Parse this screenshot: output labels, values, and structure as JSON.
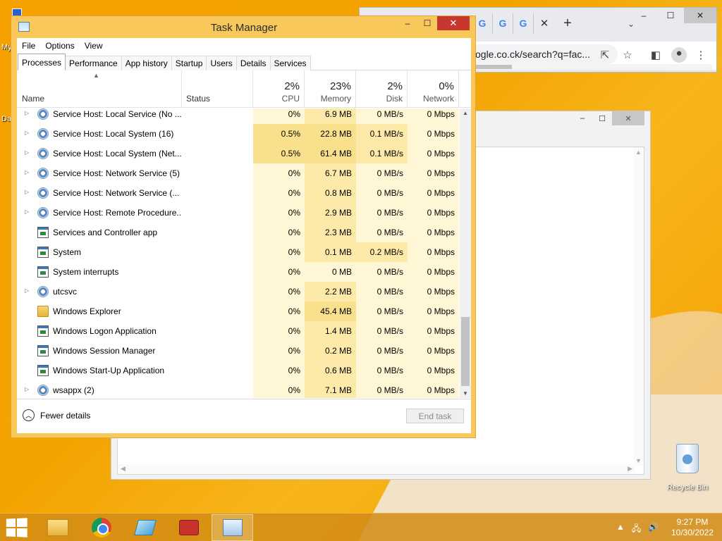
{
  "desktop": {
    "frag_my": "My",
    "frag_da": "Da",
    "recycle_bin_label": "Recycle Bin"
  },
  "chrome": {
    "tab_favicon": "G",
    "tab_close": "✕",
    "new_tab": "+",
    "tab_dropdown": "⌄",
    "url": "ogle.co.ck/search?q=fac...",
    "minimize": "–",
    "maximize": "☐",
    "close": "✕"
  },
  "explorer": {
    "minimize": "–",
    "maximize": "☐",
    "close": "✕"
  },
  "task_manager": {
    "title": "Task Manager",
    "minimize": "–",
    "maximize": "☐",
    "close": "✕",
    "menu": [
      "File",
      "Options",
      "View"
    ],
    "tabs": [
      "Processes",
      "Performance",
      "App history",
      "Startup",
      "Users",
      "Details",
      "Services"
    ],
    "active_tab": "Processes",
    "columns": {
      "name": "Name",
      "status": "Status",
      "cpu_pct": "2%",
      "cpu": "CPU",
      "memory_pct": "23%",
      "memory": "Memory",
      "disk_pct": "2%",
      "disk": "Disk",
      "network_pct": "0%",
      "network": "Network"
    },
    "processes": [
      {
        "name": "Service Host: Local Service (No ...",
        "expandable": true,
        "icon": "gear-icon",
        "cpu": "0%",
        "memory": "6.9 MB",
        "disk": "0 MB/s",
        "network": "0 Mbps"
      },
      {
        "name": "Service Host: Local System (16)",
        "expandable": true,
        "icon": "gear-icon",
        "cpu": "0.5%",
        "memory": "22.8 MB",
        "disk": "0.1 MB/s",
        "network": "0 Mbps"
      },
      {
        "name": "Service Host: Local System (Net...",
        "expandable": true,
        "icon": "gear-icon",
        "cpu": "0.5%",
        "memory": "61.4 MB",
        "disk": "0.1 MB/s",
        "network": "0 Mbps"
      },
      {
        "name": "Service Host: Network Service (5)",
        "expandable": true,
        "icon": "gear-icon",
        "cpu": "0%",
        "memory": "6.7 MB",
        "disk": "0 MB/s",
        "network": "0 Mbps"
      },
      {
        "name": "Service Host: Network Service (...",
        "expandable": true,
        "icon": "gear-icon",
        "cpu": "0%",
        "memory": "0.8 MB",
        "disk": "0 MB/s",
        "network": "0 Mbps"
      },
      {
        "name": "Service Host: Remote Procedure...",
        "expandable": true,
        "icon": "gear-icon",
        "cpu": "0%",
        "memory": "2.9 MB",
        "disk": "0 MB/s",
        "network": "0 Mbps"
      },
      {
        "name": "Services and Controller app",
        "expandable": false,
        "icon": "app-window-icon",
        "cpu": "0%",
        "memory": "2.3 MB",
        "disk": "0 MB/s",
        "network": "0 Mbps"
      },
      {
        "name": "System",
        "expandable": false,
        "icon": "app-window-icon",
        "cpu": "0%",
        "memory": "0.1 MB",
        "disk": "0.2 MB/s",
        "network": "0 Mbps"
      },
      {
        "name": "System interrupts",
        "expandable": false,
        "icon": "app-window-icon",
        "cpu": "0%",
        "memory": "0 MB",
        "disk": "0 MB/s",
        "network": "0 Mbps"
      },
      {
        "name": "utcsvc",
        "expandable": true,
        "icon": "gear-icon",
        "cpu": "0%",
        "memory": "2.2 MB",
        "disk": "0 MB/s",
        "network": "0 Mbps"
      },
      {
        "name": "Windows Explorer",
        "expandable": false,
        "icon": "folder-icon",
        "cpu": "0%",
        "memory": "45.4 MB",
        "disk": "0 MB/s",
        "network": "0 Mbps"
      },
      {
        "name": "Windows Logon Application",
        "expandable": false,
        "icon": "app-window-icon",
        "cpu": "0%",
        "memory": "1.4 MB",
        "disk": "0 MB/s",
        "network": "0 Mbps"
      },
      {
        "name": "Windows Session Manager",
        "expandable": false,
        "icon": "app-window-icon",
        "cpu": "0%",
        "memory": "0.2 MB",
        "disk": "0 MB/s",
        "network": "0 Mbps"
      },
      {
        "name": "Windows Start-Up Application",
        "expandable": false,
        "icon": "app-window-icon",
        "cpu": "0%",
        "memory": "0.6 MB",
        "disk": "0 MB/s",
        "network": "0 Mbps"
      },
      {
        "name": "wsappx (2)",
        "expandable": true,
        "icon": "gear-icon",
        "cpu": "0%",
        "memory": "7.1 MB",
        "disk": "0 MB/s",
        "network": "0 Mbps"
      }
    ],
    "fewer_details": "Fewer details",
    "end_task": "End task"
  },
  "taskbar": {
    "clock_time": "9:27 PM",
    "clock_date": "10/30/2022",
    "tray_chevron": "▲",
    "tray_network": "🖧",
    "tray_volume": "🔊"
  },
  "colors": {
    "heat_light": "#fff6d6",
    "heat_mid": "#fdeaa9",
    "heat_strong": "#f9e08c",
    "close_red": "#c7372f",
    "wallpaper": "#f4a100"
  }
}
